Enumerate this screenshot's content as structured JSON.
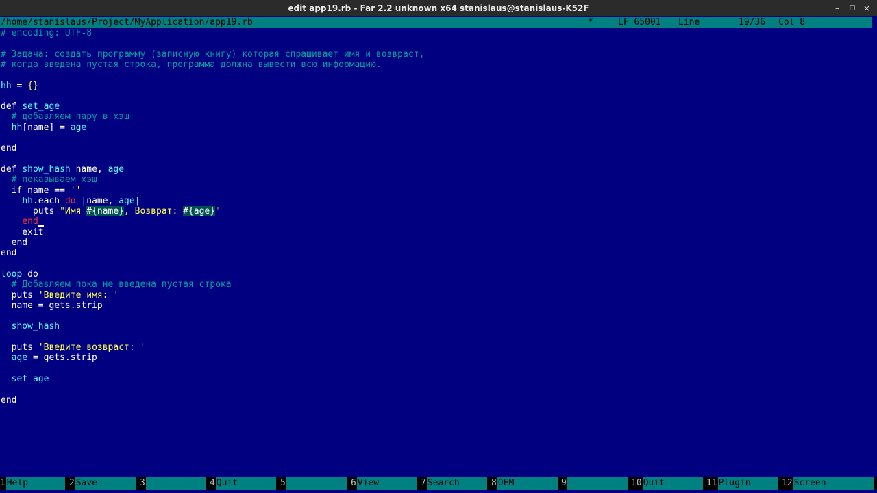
{
  "window": {
    "title": "edit app19.rb - Far 2.2 unknown x64 stanislaus@stanislaus-K52F",
    "controls": {
      "minimize": "–",
      "maximize": "□",
      "close": "×"
    }
  },
  "status": {
    "path": "/home/stanislaus/Project/MyApplication/app19.rb",
    "modified": "*",
    "eol_codepage": "LF 65001",
    "line_label": "Line",
    "line_pos": "19/36",
    "col": "Col 8"
  },
  "colors": {
    "background": "#000080",
    "comment": "#00a0a0",
    "string": "#ffff55",
    "identifier_cyan": "#55ffff",
    "text": "#ffffff",
    "keyword_red": "#ff3333",
    "status_bar": "#008080"
  },
  "code": [
    {
      "row": 0,
      "tokens": [
        {
          "t": "# encoding: UTF-8",
          "k": "c"
        }
      ]
    },
    {
      "row": 2,
      "tokens": [
        {
          "t": "# Задача: создать программу (записную книгу) которая спрашивает имя и возвраст,",
          "k": "c"
        }
      ]
    },
    {
      "row": 3,
      "tokens": [
        {
          "t": "# когда введена пустая строка, программа должна вывести всю информацию.",
          "k": "c"
        }
      ]
    },
    {
      "row": 5,
      "tokens": [
        {
          "t": "hh",
          "k": "a"
        },
        {
          "t": " = ",
          "k": "w"
        },
        {
          "t": "{}",
          "k": "s"
        }
      ]
    },
    {
      "row": 7,
      "tokens": [
        {
          "t": "def ",
          "k": "w"
        },
        {
          "t": "set_age",
          "k": "a"
        }
      ]
    },
    {
      "row": 8,
      "tokens": [
        {
          "t": "  # добавляем пару в хэш",
          "k": "c"
        }
      ]
    },
    {
      "row": 9,
      "tokens": [
        {
          "t": "  ",
          "k": "w"
        },
        {
          "t": "hh",
          "k": "a"
        },
        {
          "t": "[name] = ",
          "k": "w"
        },
        {
          "t": "age",
          "k": "a"
        }
      ]
    },
    {
      "row": 11,
      "tokens": [
        {
          "t": "end",
          "k": "w"
        }
      ]
    },
    {
      "row": 13,
      "tokens": [
        {
          "t": "def ",
          "k": "w"
        },
        {
          "t": "show_hash",
          "k": "a"
        },
        {
          "t": " name, ",
          "k": "w"
        },
        {
          "t": "age",
          "k": "a"
        }
      ]
    },
    {
      "row": 14,
      "tokens": [
        {
          "t": "  # показываем хэш",
          "k": "c"
        }
      ]
    },
    {
      "row": 15,
      "tokens": [
        {
          "t": "  if name == ",
          "k": "w"
        },
        {
          "t": "''",
          "k": "s"
        }
      ]
    },
    {
      "row": 16,
      "tokens": [
        {
          "t": "    ",
          "k": "w"
        },
        {
          "t": "hh",
          "k": "a"
        },
        {
          "t": ".each ",
          "k": "w"
        },
        {
          "t": "do",
          "k": "r"
        },
        {
          "t": " ",
          "k": "w"
        },
        {
          "t": "|",
          "k": "a"
        },
        {
          "t": "name, ",
          "k": "w"
        },
        {
          "t": "age",
          "k": "a"
        },
        {
          "t": "|",
          "k": "a"
        }
      ]
    },
    {
      "row": 17,
      "tokens": [
        {
          "t": "      puts ",
          "k": "w"
        },
        {
          "t": "\"Имя ",
          "k": "s"
        },
        {
          "t": "#{name}",
          "k": "i"
        },
        {
          "t": ", Возврат: ",
          "k": "s"
        },
        {
          "t": "#{age}",
          "k": "i"
        },
        {
          "t": "\"",
          "k": "s"
        }
      ]
    },
    {
      "row": 18,
      "tokens": [
        {
          "t": "    ",
          "k": "w"
        },
        {
          "t": "end",
          "k": "r"
        }
      ],
      "caret": true
    },
    {
      "row": 19,
      "tokens": [
        {
          "t": "    exit",
          "k": "w"
        }
      ]
    },
    {
      "row": 20,
      "tokens": [
        {
          "t": "  end",
          "k": "w"
        }
      ]
    },
    {
      "row": 21,
      "tokens": [
        {
          "t": "end",
          "k": "w"
        }
      ]
    },
    {
      "row": 23,
      "tokens": [
        {
          "t": "loop",
          "k": "a"
        },
        {
          "t": " do",
          "k": "w"
        }
      ]
    },
    {
      "row": 24,
      "tokens": [
        {
          "t": "  # Добавляем пока не введена пустая строка",
          "k": "c"
        }
      ]
    },
    {
      "row": 25,
      "tokens": [
        {
          "t": "  puts ",
          "k": "w"
        },
        {
          "t": "'Введите имя: '",
          "k": "s"
        }
      ]
    },
    {
      "row": 26,
      "tokens": [
        {
          "t": "  name = gets.strip",
          "k": "w"
        }
      ]
    },
    {
      "row": 28,
      "tokens": [
        {
          "t": "  ",
          "k": "w"
        },
        {
          "t": "show_hash",
          "k": "a"
        }
      ]
    },
    {
      "row": 30,
      "tokens": [
        {
          "t": "  puts ",
          "k": "w"
        },
        {
          "t": "'Введите возврaст: '",
          "k": "s"
        }
      ]
    },
    {
      "row": 31,
      "tokens": [
        {
          "t": "  ",
          "k": "w"
        },
        {
          "t": "age",
          "k": "a"
        },
        {
          "t": " = gets.strip",
          "k": "w"
        }
      ]
    },
    {
      "row": 33,
      "tokens": [
        {
          "t": "  ",
          "k": "w"
        },
        {
          "t": "set_age",
          "k": "a"
        }
      ]
    },
    {
      "row": 35,
      "tokens": [
        {
          "t": "end",
          "k": "w"
        }
      ]
    }
  ],
  "keybar": [
    {
      "num": "1",
      "label": "Help"
    },
    {
      "num": "2",
      "label": "Save"
    },
    {
      "num": "3",
      "label": ""
    },
    {
      "num": "4",
      "label": "Quit"
    },
    {
      "num": "5",
      "label": ""
    },
    {
      "num": "6",
      "label": "View"
    },
    {
      "num": "7",
      "label": "Search"
    },
    {
      "num": "8",
      "label": "OEM"
    },
    {
      "num": "9",
      "label": ""
    },
    {
      "num": "10",
      "label": "Quit"
    },
    {
      "num": "11",
      "label": "Plugin"
    },
    {
      "num": "12",
      "label": "Screen"
    }
  ]
}
